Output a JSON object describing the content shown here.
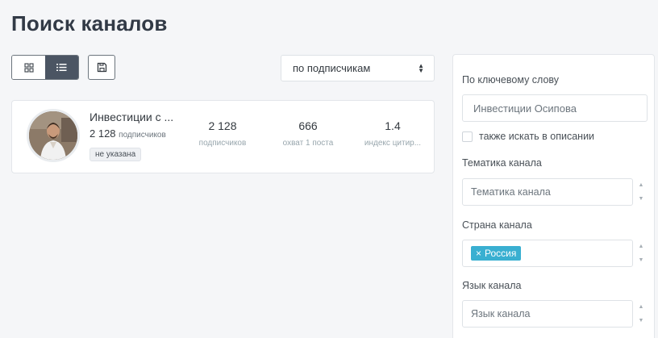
{
  "page": {
    "title": "Поиск каналов"
  },
  "toolbar": {
    "grid_view_icon": "grid-icon",
    "list_view_icon": "list-icon",
    "save_icon": "save-icon",
    "sort_value": "по подписчикам"
  },
  "channel": {
    "name": "Инвестиции с ...",
    "subscribers_count": "2 128",
    "subscribers_word": "подписчиков",
    "badge": "не указана",
    "stats": [
      {
        "value": "2 128",
        "label": "подписчиков"
      },
      {
        "value": "666",
        "label": "охват 1 поста"
      },
      {
        "value": "1.4",
        "label": "индекс цитир..."
      }
    ]
  },
  "filters": {
    "keyword_label": "По ключевому слову",
    "keyword_value": "Инвестиции Осипова",
    "search_description_label": "также искать в описании",
    "topic_label": "Тематика канала",
    "topic_placeholder": "Тематика канала",
    "country_label": "Страна канала",
    "country_tag": "Россия",
    "country_tag_remove": "×",
    "language_label": "Язык канала",
    "language_placeholder": "Язык канала"
  },
  "colors": {
    "accent": "#39afd1",
    "active_button": "#4b5563"
  }
}
